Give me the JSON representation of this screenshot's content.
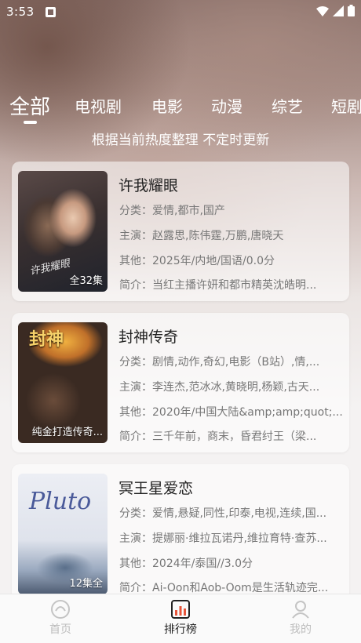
{
  "status": {
    "time": "3:53"
  },
  "tabs": [
    "全部",
    "电视剧",
    "电影",
    "动漫",
    "综艺",
    "短剧"
  ],
  "subtitle": "根据当前热度整理 不定时更新",
  "cards": [
    {
      "title": "许我耀眼",
      "poster_note": "全32集",
      "category": "分类：爱情,都市,国产",
      "cast": "主演：赵露思,陈伟霆,万鹏,唐晓天",
      "other": "其他：2025年/内地/国语/0.0分",
      "summary": "简介：当红主播许妍和都市精英沈皓明..."
    },
    {
      "title": "封神传奇",
      "poster_note": "纯金打造传奇...",
      "category": "分类：剧情,动作,奇幻,电影（B站）,情,...",
      "cast": "主演：李连杰,范冰冰,黄晓明,杨颖,古天...",
      "other": "其他：2020年/中国大陆&amp;amp;quot;...",
      "summary": "简介：三千年前，商末，昏君纣王（梁..."
    },
    {
      "title": "冥王星爱恋",
      "poster_note": "12集全",
      "category": "分类：爱情,悬疑,同性,印泰,电视,连续,国...",
      "cast": "主演：提娜丽·维拉瓦诺丹,维拉育特·查苏...",
      "other": "其他：2024年/泰国//3.0分",
      "summary": "简介：Ai-Oon和Aob-Oom是生活轨迹完..."
    }
  ],
  "nav": [
    {
      "label": "首页",
      "icon": "home-icon"
    },
    {
      "label": "排行榜",
      "icon": "ranking-icon"
    },
    {
      "label": "我的",
      "icon": "profile-icon"
    }
  ],
  "colors": {
    "active_nav": "#222222",
    "inactive_nav": "#bdbdbd",
    "accent_rank": "#e8553a"
  }
}
